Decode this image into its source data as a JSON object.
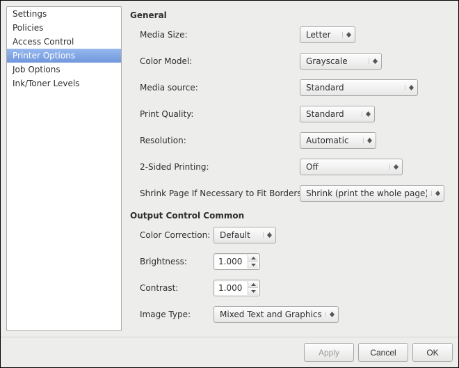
{
  "sidebar": {
    "items": [
      {
        "label": "Settings"
      },
      {
        "label": "Policies"
      },
      {
        "label": "Access Control"
      },
      {
        "label": "Printer Options"
      },
      {
        "label": "Job Options"
      },
      {
        "label": "Ink/Toner Levels"
      }
    ],
    "selected_index": 3
  },
  "sections": {
    "general": {
      "title": "General",
      "media_size": {
        "label": "Media Size:",
        "value": "Letter"
      },
      "color_model": {
        "label": "Color Model:",
        "value": "Grayscale"
      },
      "media_source": {
        "label": "Media source:",
        "value": "Standard"
      },
      "print_quality": {
        "label": "Print Quality:",
        "value": "Standard"
      },
      "resolution": {
        "label": "Resolution:",
        "value": "Automatic"
      },
      "two_sided": {
        "label": "2-Sided Printing:",
        "value": "Off"
      },
      "shrink": {
        "label": "Shrink Page If Necessary to Fit Borders:",
        "value": "Shrink (print the whole page)"
      }
    },
    "output": {
      "title": "Output Control Common",
      "color_correction": {
        "label": "Color Correction:",
        "value": "Default"
      },
      "brightness": {
        "label": "Brightness:",
        "value": "1.000"
      },
      "contrast": {
        "label": "Contrast:",
        "value": "1.000"
      },
      "image_type": {
        "label": "Image Type:",
        "value": "Mixed Text and Graphics"
      }
    }
  },
  "footer": {
    "apply": "Apply",
    "cancel": "Cancel",
    "ok": "OK"
  }
}
